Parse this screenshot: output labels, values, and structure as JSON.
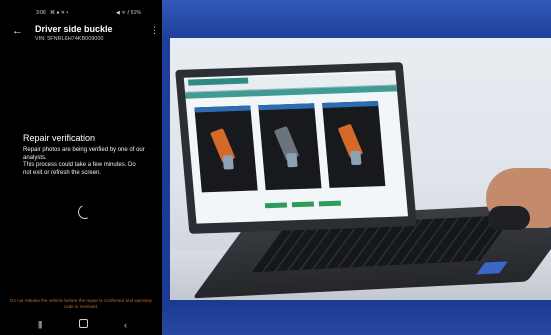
{
  "phone": {
    "status_time": "3:06",
    "status_left_icons": "⌘ ● ✕ •",
    "status_right": "◀ ᯤ ⫽ 51%",
    "battery_percent": "51%",
    "title": "Driver side buckle",
    "vin": "VIN: 5FNRL6H74KB009000",
    "heading": "Repair verification",
    "body": "Repair photos are being verified by one of our analysts.\nThis process could take a few minutes. Do not exit or refresh the screen.",
    "warning": "Do not release the vehicle before the repair is confirmed and warranty code is received.",
    "icons": {
      "back": "arrow-left-icon",
      "menu": "more-vertical-icon",
      "spinner": "loading-spinner-icon",
      "nav_recents": "recents-icon",
      "nav_home": "home-icon",
      "nav_back": "back-icon"
    }
  },
  "colors": {
    "background_blue": "#1d3c95",
    "warning_orange": "#c06c2a",
    "phone_bg": "#000000"
  }
}
